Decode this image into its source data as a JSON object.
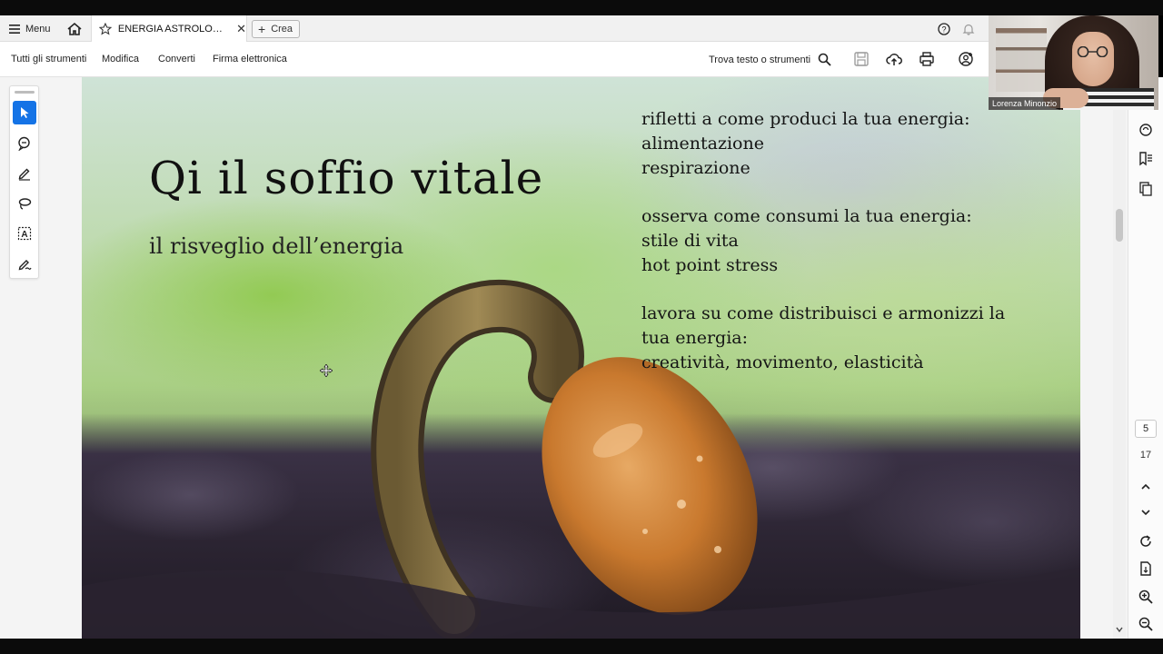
{
  "tabbar": {
    "menu_label": "Menu",
    "document_tab_title": "ENERGIA ASTROLOG...",
    "create_label": "Crea"
  },
  "toolbar": {
    "items": [
      "Tutti gli strumenti",
      "Modifica",
      "Converti",
      "Firma elettronica"
    ],
    "find_label": "Trova testo o strumenti"
  },
  "slide": {
    "title": "Qi il soffio vitale",
    "subtitle": "il risveglio dell’energia",
    "paragraphs": [
      [
        "rifletti a come produci la tua energia:",
        "alimentazione",
        "respirazione"
      ],
      [
        "osserva come consumi la tua energia:",
        "stile di vita",
        "hot point stress"
      ],
      [
        "lavora su come distribuisci e armonizzi la",
        "tua energia:",
        "creatività, movimento, elasticità"
      ]
    ]
  },
  "navigation": {
    "current_page": "5",
    "total_pages": "17"
  },
  "webcam": {
    "participant_name": "Lorenza Minonzio"
  },
  "colors": {
    "accent": "#1473e6",
    "toolbar_bg": "#ffffff",
    "tabbar_bg": "#f1f1f1"
  },
  "icons": {
    "left_tools": [
      "select-arrow-icon",
      "comment-add-icon",
      "highlight-pen-icon",
      "lasso-draw-icon",
      "text-box-icon",
      "signature-pen-icon"
    ],
    "right_rail": [
      "comment-icon",
      "bookmark-list-icon",
      "pages-copy-icon",
      "chevron-up-icon",
      "chevron-down-icon",
      "refresh-icon",
      "document-export-icon",
      "zoom-in-icon",
      "zoom-out-icon"
    ]
  }
}
